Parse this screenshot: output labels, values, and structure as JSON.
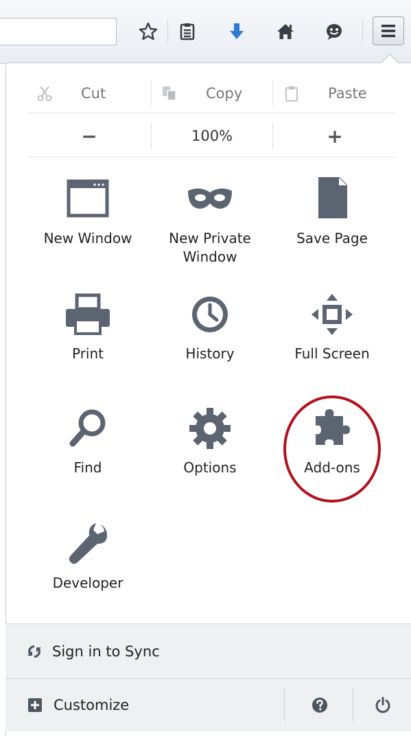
{
  "toolbar": {
    "icons": [
      "bookmark-star-icon",
      "reading-list-icon",
      "downloads-arrow-icon",
      "home-icon",
      "chat-icon"
    ],
    "menu_icon": "hamburger-menu-icon",
    "colors": {
      "download_blue": "#2f7ad4",
      "icon_gray": "#3a3f45"
    }
  },
  "edit": {
    "cut": "Cut",
    "copy": "Copy",
    "paste": "Paste"
  },
  "zoom": {
    "minus": "−",
    "level": "100%",
    "plus": "+"
  },
  "grid": {
    "new_window": "New Window",
    "new_private_line1": "New Private",
    "new_private_line2": "Window",
    "save_page": "Save Page",
    "print": "Print",
    "history": "History",
    "full_screen": "Full Screen",
    "find": "Find",
    "options": "Options",
    "addons": "Add-ons",
    "developer": "Developer",
    "icon_color": "#5b6470",
    "highlight_color": "#b3121c"
  },
  "footer": {
    "sync": "Sign in to Sync",
    "customize": "Customize"
  }
}
